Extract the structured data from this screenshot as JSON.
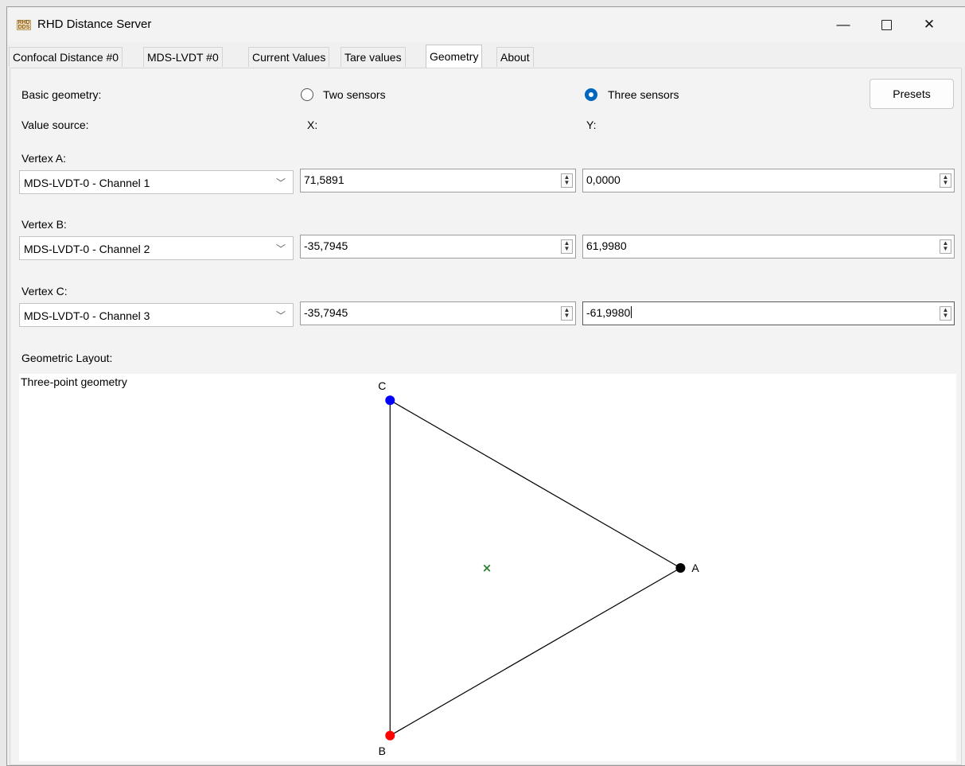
{
  "window": {
    "title": "RHD Distance Server",
    "icon_text": "RHD\nDDS",
    "controls": {
      "minimize": "—",
      "maximize": "",
      "close": "✕"
    }
  },
  "tabs": [
    {
      "label": "Confocal Distance #0",
      "active": false
    },
    {
      "label": "MDS-LVDT #0",
      "active": false
    },
    {
      "label": "Current Values",
      "active": false
    },
    {
      "label": "Tare values",
      "active": false
    },
    {
      "label": "Geometry",
      "active": true
    },
    {
      "label": "About",
      "active": false
    }
  ],
  "geometry": {
    "basic_geometry_label": "Basic geometry:",
    "options": [
      {
        "label": "Two sensors",
        "checked": false
      },
      {
        "label": "Three sensors",
        "checked": true
      }
    ],
    "presets_label": "Presets",
    "value_source_label": "Value source:",
    "x_label": "X:",
    "y_label": "Y:",
    "vertices": [
      {
        "label": "Vertex A:",
        "source": "MDS-LVDT-0 - Channel 1",
        "x": "71,5891",
        "y": "0,0000"
      },
      {
        "label": "Vertex B:",
        "source": "MDS-LVDT-0 - Channel 2",
        "x": "-35,7945",
        "y": "61,9980"
      },
      {
        "label": "Vertex C:",
        "source": "MDS-LVDT-0 - Channel 3",
        "x": "-35,7945",
        "y": "-61,9980"
      }
    ],
    "layout_label": "Geometric Layout:",
    "canvas_title": "Three-point geometry"
  },
  "plot": {
    "points": [
      {
        "name": "A",
        "x": 71.5891,
        "y": 0.0,
        "color": "#000000"
      },
      {
        "name": "B",
        "x": -35.7945,
        "y": 61.998,
        "color": "#ff0000"
      },
      {
        "name": "C",
        "x": -35.7945,
        "y": -61.998,
        "color": "#0000ff"
      }
    ],
    "center": {
      "x": 0,
      "y": 0,
      "marker": "×",
      "color": "#2e7d32"
    },
    "edge_color": "#000000"
  }
}
